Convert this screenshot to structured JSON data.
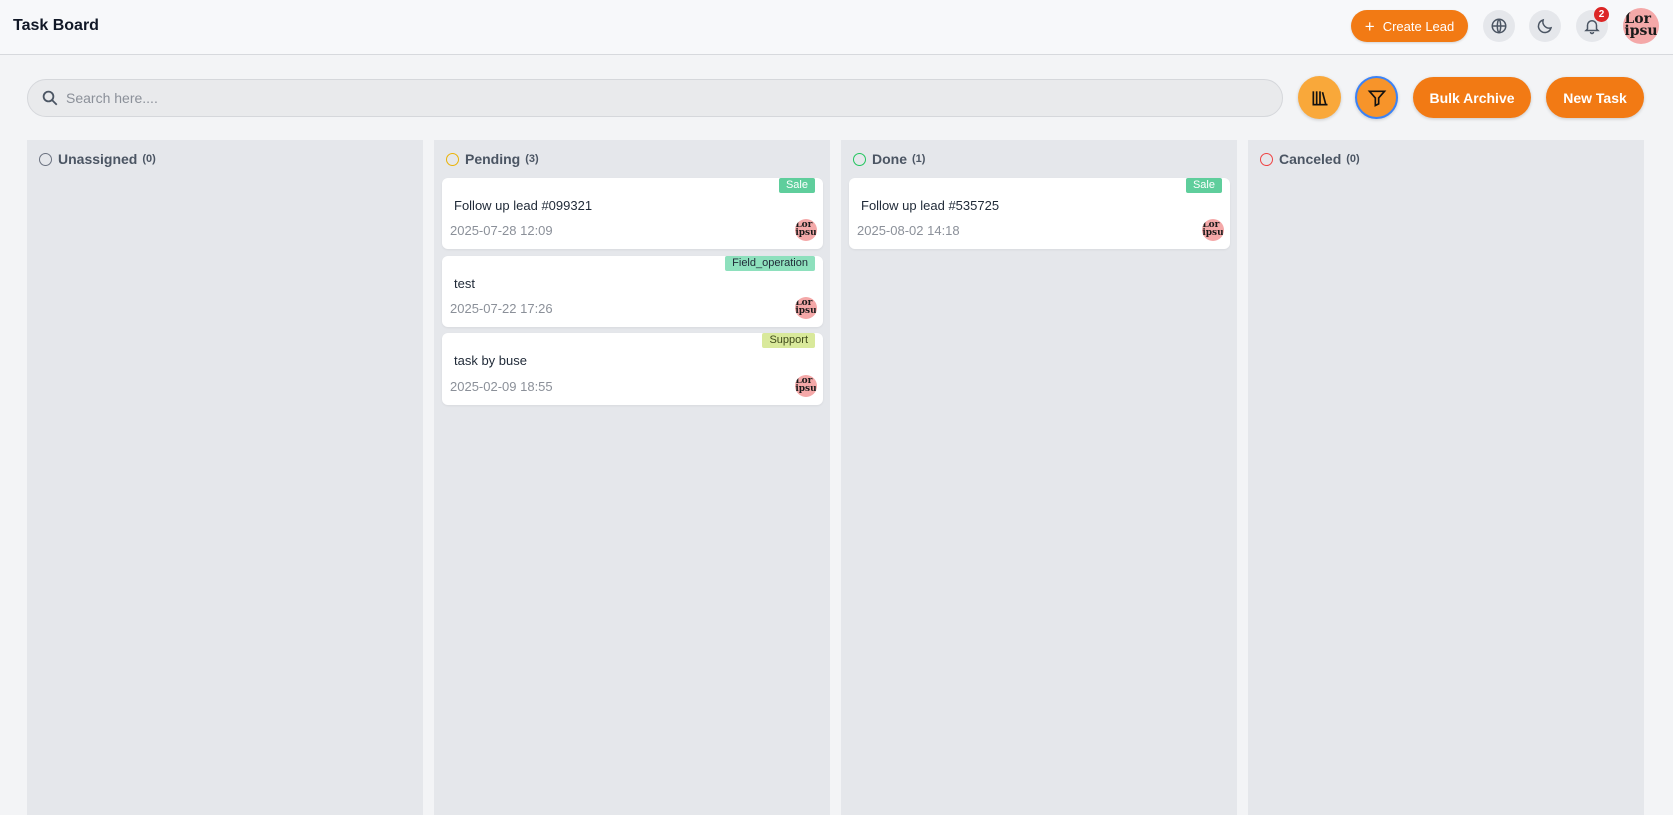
{
  "header": {
    "title": "Task Board",
    "create_lead_label": "Create Lead",
    "notification_count": "2",
    "avatar_text_1": "Lor",
    "avatar_text_2": "ipsu"
  },
  "toolbar": {
    "search_placeholder": "Search here....",
    "bulk_archive_label": "Bulk Archive",
    "new_task_label": "New Task"
  },
  "colors": {
    "accent": "#f27a14",
    "pending": "#eab308",
    "done": "#22c55e",
    "canceled": "#ef4444",
    "unassigned": "#6b7280"
  },
  "columns": [
    {
      "title": "Unassigned",
      "count": "(0)",
      "cards": []
    },
    {
      "title": "Pending",
      "count": "(3)",
      "cards": [
        {
          "tag": "Sale",
          "title": "Follow up lead #099321",
          "date": "2025-07-28 12:09"
        },
        {
          "tag": "Field_operation",
          "title": "test",
          "date": "2025-07-22 17:26"
        },
        {
          "tag": "Support",
          "title": "task by buse",
          "date": "2025-02-09 18:55"
        }
      ]
    },
    {
      "title": "Done",
      "count": "(1)",
      "cards": [
        {
          "tag": "Sale",
          "title": "Follow up lead #535725",
          "date": "2025-08-02 14:18"
        }
      ]
    },
    {
      "title": "Canceled",
      "count": "(0)",
      "cards": []
    }
  ]
}
